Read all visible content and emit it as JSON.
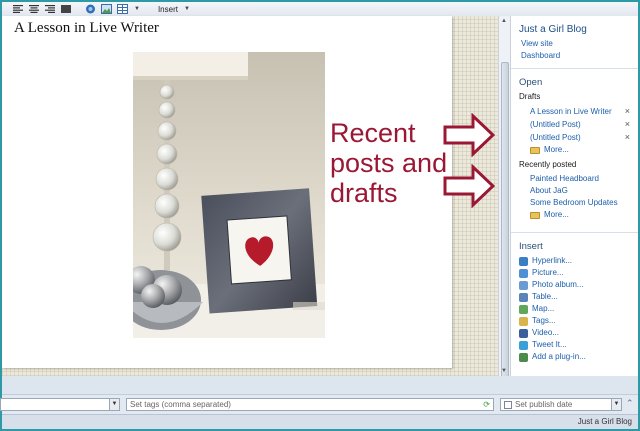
{
  "toolbar": {
    "icons": [
      "align-left-icon",
      "align-center-icon",
      "align-right-icon",
      "align-justify-icon",
      "hyperlink-icon",
      "picture-icon",
      "table-icon"
    ],
    "insert_label": "Insert"
  },
  "editor": {
    "post_title": "A Lesson in Live Writer"
  },
  "annotation": {
    "lines": [
      "Recent",
      "posts and",
      "drafts"
    ],
    "color": "#9b1835"
  },
  "sidebar": {
    "blog_name": "Just a Girl Blog",
    "blog_links": [
      "View site",
      "Dashboard"
    ],
    "open_heading": "Open",
    "drafts_label": "Drafts",
    "drafts": [
      "A Lesson in Live Writer",
      "(Untitled Post)",
      "(Untitled Post)"
    ],
    "drafts_more": "More...",
    "recent_label": "Recently posted",
    "recent": [
      "Painted Headboard",
      "About JaG",
      "Some Bedroom Updates"
    ],
    "recent_more": "More...",
    "insert_heading": "Insert",
    "insert_items": [
      {
        "label": "Hyperlink...",
        "icon": "hyperlink-icon",
        "color": "#3a7fc4"
      },
      {
        "label": "Picture...",
        "icon": "picture-icon",
        "color": "#4f8fd6"
      },
      {
        "label": "Photo album...",
        "icon": "photo-album-icon",
        "color": "#6b9bd3"
      },
      {
        "label": "Table...",
        "icon": "table-icon",
        "color": "#5a83b8"
      },
      {
        "label": "Map...",
        "icon": "map-icon",
        "color": "#5fa75a"
      },
      {
        "label": "Tags...",
        "icon": "tags-icon",
        "color": "#d9b44a"
      },
      {
        "label": "Video...",
        "icon": "video-icon",
        "color": "#3d5e9c"
      },
      {
        "label": "Tweet It...",
        "icon": "tweet-icon",
        "color": "#3aa0d8"
      },
      {
        "label": "Add a plug-in...",
        "icon": "plugin-icon",
        "color": "#4a8a4a"
      }
    ]
  },
  "bottom_bar": {
    "tags_placeholder": "Set tags (comma separated)",
    "publish_date_placeholder": "Set publish date"
  },
  "status": {
    "blog_name": "Just a Girl Blog"
  }
}
